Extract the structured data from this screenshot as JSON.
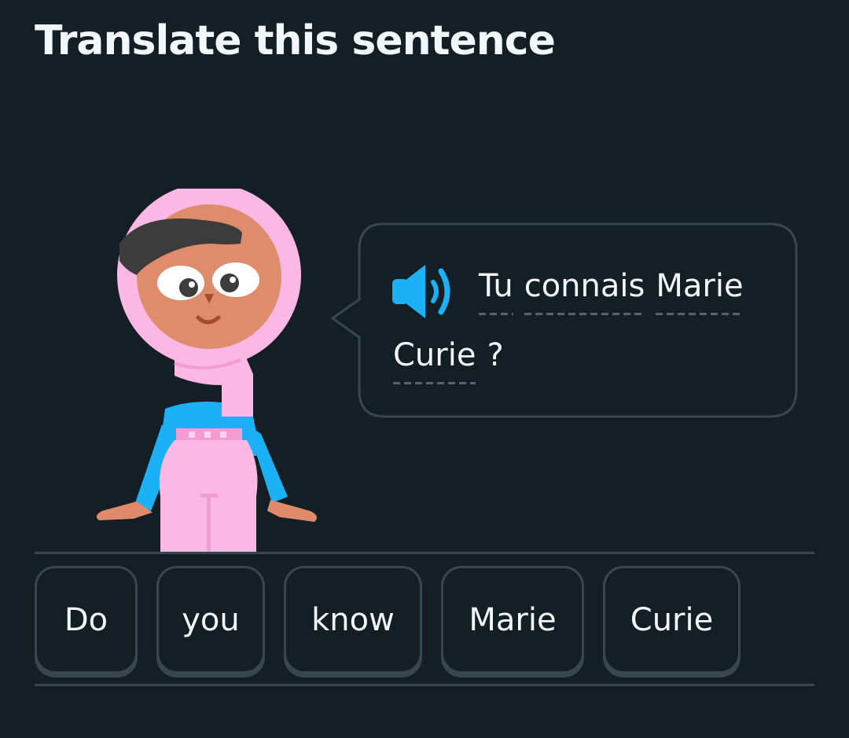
{
  "header": {
    "title": "Translate this sentence"
  },
  "prompt": {
    "audio_icon": "speaker-icon",
    "words": [
      "Tu",
      "connais",
      "Marie",
      "Curie",
      "?"
    ]
  },
  "word_bank": {
    "chips": [
      "Do",
      "you",
      "know",
      "Marie",
      "Curie"
    ]
  },
  "colors": {
    "background": "#131f24",
    "border": "#37464f",
    "text": "#f1f7fb",
    "speaker": "#1cb0f6",
    "dotted_underline": "#52656d"
  }
}
